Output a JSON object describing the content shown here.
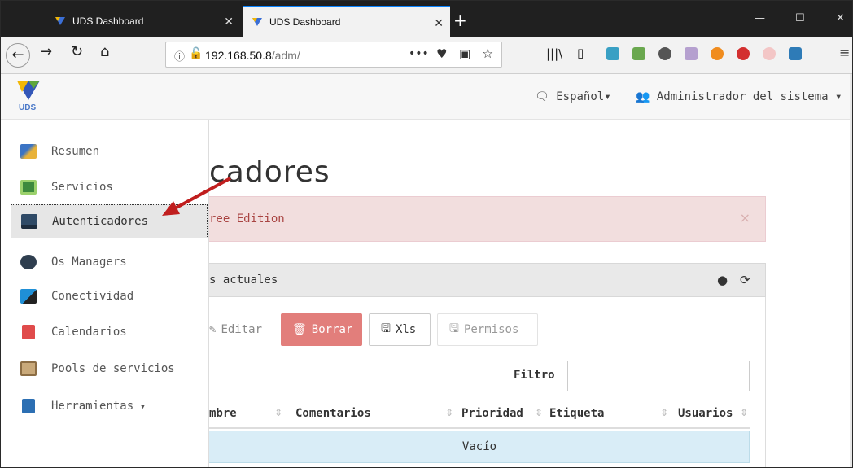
{
  "browser": {
    "tabs": [
      {
        "label": "UDS Dashboard",
        "active": false
      },
      {
        "label": "UDS Dashboard",
        "active": true
      }
    ],
    "new_tab": "+",
    "url_host": "192.168.50.8",
    "url_path": "/adm/",
    "menu_dots": "•••",
    "window_controls": {
      "minimize": "—",
      "maximize": "☐",
      "close": "✕"
    },
    "accent": "#0a84ff"
  },
  "app": {
    "logo_text": "UDS",
    "language": "Español",
    "user": "Administrador del sistema"
  },
  "sidebar": {
    "items": [
      {
        "label": "Resumen",
        "icon": "summary-icon"
      },
      {
        "label": "Servicios",
        "icon": "services-icon"
      },
      {
        "label": "Autenticadores",
        "icon": "authenticators-icon",
        "active": true
      },
      {
        "label": "Os Managers",
        "icon": "os-managers-icon"
      },
      {
        "label": "Conectividad",
        "icon": "connectivity-icon"
      },
      {
        "label": "Calendarios",
        "icon": "calendar-icon"
      },
      {
        "label": "Pools de servicios",
        "icon": "pools-icon"
      },
      {
        "label": "Herramientas",
        "icon": "tools-icon"
      }
    ]
  },
  "main": {
    "title": "cadores",
    "alert_text": "ree Edition",
    "alert_close": "×",
    "panel_title": "s actuales",
    "buttons": {
      "edit": "Editar",
      "delete": "Borrar",
      "xls": "Xls",
      "permissions": "Permisos"
    },
    "filter_label": "Filtro",
    "filter_value": "",
    "columns": [
      "mbre",
      "Comentarios",
      "Prioridad",
      "Etiqueta",
      "Usuarios"
    ],
    "empty_text": "Vacío"
  }
}
